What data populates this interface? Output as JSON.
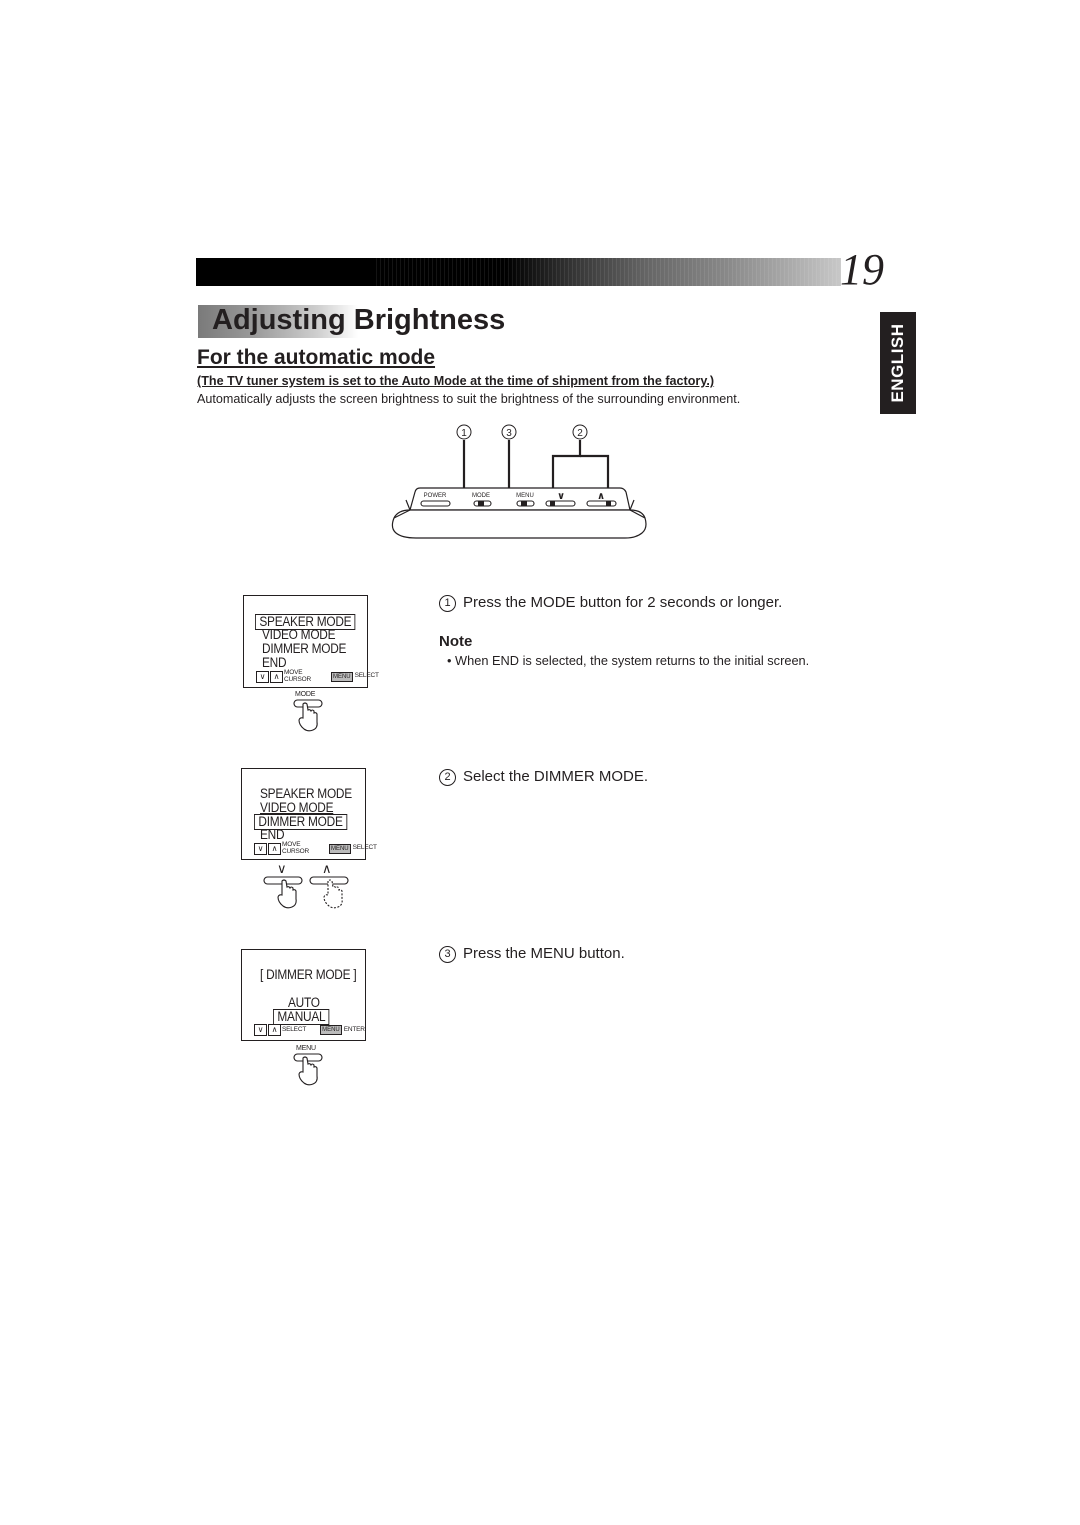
{
  "header": {
    "page_number": "19",
    "title": "Adjusting Brightness",
    "language_tab": "ENGLISH"
  },
  "section": {
    "title": "For the automatic mode",
    "factory_note": "(The TV tuner system is set to the Auto Mode at the time of shipment from the factory.)",
    "description": "Automatically adjusts the screen brightness to suit the brightness of the surrounding environment."
  },
  "remote": {
    "callouts": [
      "1",
      "3",
      "2"
    ],
    "buttons": {
      "power": "POWER",
      "mode": "MODE",
      "menu": "MENU",
      "down": "∨",
      "up": "∧"
    }
  },
  "osd_screens": [
    {
      "lines": [
        "SPEAKER MODE",
        "VIDEO MODE",
        "DIMMER MODE",
        "END"
      ],
      "selected_index": 0,
      "footer_left_top": "MOVE",
      "footer_left_bottom": "CURSOR",
      "footer_key": "MENU",
      "footer_right": "SELECT",
      "button_label": "MODE"
    },
    {
      "lines": [
        "SPEAKER MODE",
        "VIDEO MODE",
        "DIMMER MODE",
        "END"
      ],
      "selected_index": 2,
      "footer_left_top": "MOVE",
      "footer_left_bottom": "CURSOR",
      "footer_key": "MENU",
      "footer_right": "SELECT",
      "button_down": "∨",
      "button_up": "∧"
    },
    {
      "heading": "[ DIMMER MODE ]",
      "lines": [
        "AUTO",
        "MANUAL"
      ],
      "selected_index": 1,
      "footer_left": "SELECT",
      "footer_key": "MENU",
      "footer_right": "ENTER",
      "button_label": "MENU"
    }
  ],
  "steps": [
    {
      "number": "1",
      "text": "Press the MODE button for 2 seconds or longer."
    },
    {
      "number": "2",
      "text": "Select the DIMMER MODE."
    },
    {
      "number": "3",
      "text": "Press the MENU button."
    }
  ],
  "note": {
    "heading": "Note",
    "bullet": "•  When END is selected, the system returns to the initial screen."
  }
}
